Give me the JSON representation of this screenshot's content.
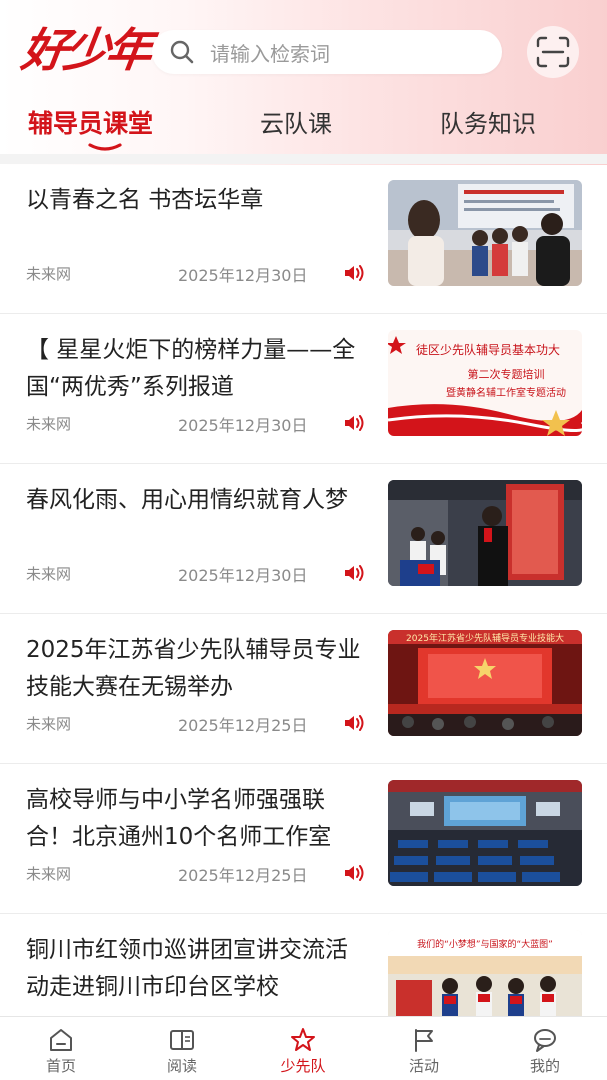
{
  "header": {
    "logo_text": "好少年",
    "search_placeholder": "请输入检索词"
  },
  "tabs": [
    {
      "label": "辅导员课堂",
      "active": true
    },
    {
      "label": "云队课",
      "active": false
    },
    {
      "label": "队务知识",
      "active": false
    }
  ],
  "articles": [
    {
      "title": "以青春之名  书杏坛华章",
      "source": "未来网",
      "date": "2025年12月30日"
    },
    {
      "title": "【 星星火炬下的榜样力量——全国“两优秀”系列报道",
      "source": "未来网",
      "date": "2025年12月30日"
    },
    {
      "title": "春风化雨、用心用情织就育人梦",
      "source": "未来网",
      "date": "2025年12月30日"
    },
    {
      "title": "2025年江苏省少先队辅导员专业技能大赛在无锡举办",
      "source": "未来网",
      "date": "2025年12月25日"
    },
    {
      "title": "高校导师与中小学名师强强联合！北京通州10个名师工作室",
      "source": "未来网",
      "date": "2025年12月25日"
    },
    {
      "title": "铜川市红领巾巡讲团宣讲交流活动走进铜川市印台区学校",
      "source": "",
      "date": ""
    }
  ],
  "thumb_texts": {
    "t2_line1": "徒区少先队辅导员基本功大",
    "t2_line2": "第二次专题培训",
    "t2_line3": "暨黄静名辅工作室专题活动",
    "t4_banner": "2025年江苏省少先队辅导员专业技能大",
    "t6_banner": "我们的“小梦想”与国家的“大蓝图”"
  },
  "bottom_nav": [
    {
      "label": "首页",
      "icon": "home-icon",
      "active": false
    },
    {
      "label": "阅读",
      "icon": "book-icon",
      "active": false
    },
    {
      "label": "少先队",
      "icon": "star-icon",
      "active": true
    },
    {
      "label": "活动",
      "icon": "flag-icon",
      "active": false
    },
    {
      "label": "我的",
      "icon": "profile-icon",
      "active": false
    }
  ],
  "colors": {
    "accent": "#d3141a",
    "muted": "#8a8a8a"
  }
}
